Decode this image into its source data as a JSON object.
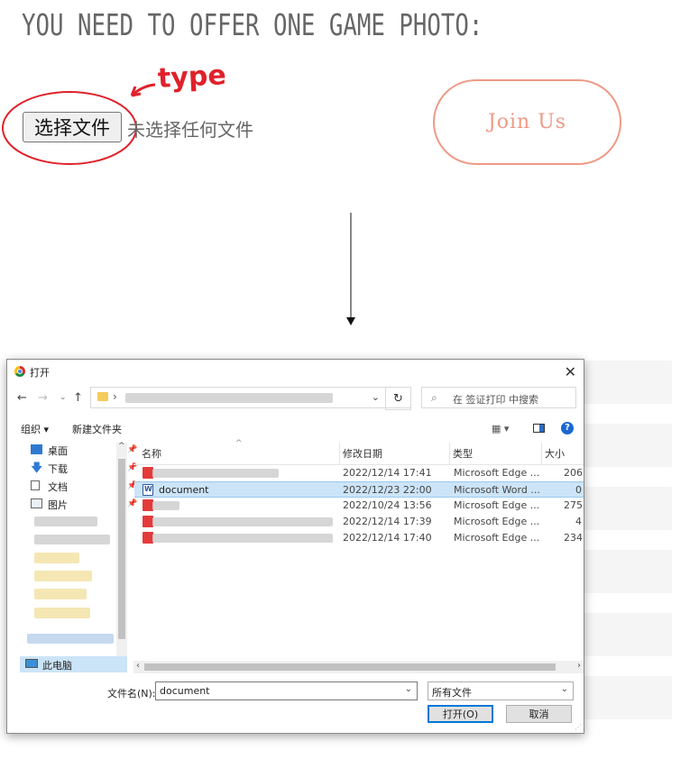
{
  "page": {
    "heading": "YOU NEED TO OFFER ONE GAME PHOTO:",
    "file_button_label": "选择文件",
    "file_status": "未选择任何文件",
    "join_button_label": "Join Us",
    "annotation_text": "type"
  },
  "dialog": {
    "title": "打开",
    "search_placeholder": "在 签证打印 中搜索",
    "toolbar": {
      "organize": "组织 ▾",
      "new_folder": "新建文件夹"
    },
    "nav_pane": {
      "desktop": "桌面",
      "downloads": "下载",
      "documents": "文档",
      "pictures": "图片",
      "this_pc": "此电脑"
    },
    "columns": {
      "name": "名称",
      "modified": "修改日期",
      "type": "类型",
      "size": "大小"
    },
    "files": [
      {
        "name": "",
        "modified": "2022/12/14 17:41",
        "type": "Microsoft Edge ...",
        "size": "206",
        "icon": "pdf-icon",
        "selected": false
      },
      {
        "name": "document",
        "modified": "2022/12/23 22:00",
        "type": "Microsoft Word ...",
        "size": "0",
        "icon": "word-icon",
        "selected": true
      },
      {
        "name": "",
        "modified": "2022/10/24 13:56",
        "type": "Microsoft Edge ...",
        "size": "275",
        "icon": "pdf-icon",
        "selected": false
      },
      {
        "name": "",
        "modified": "2022/12/14 17:39",
        "type": "Microsoft Edge ...",
        "size": "4",
        "icon": "pdf-icon",
        "selected": false
      },
      {
        "name": "",
        "modified": "2022/12/14 17:40",
        "type": "Microsoft Edge ...",
        "size": "234",
        "icon": "pdf-icon",
        "selected": false
      }
    ],
    "filename_label": "文件名(N):",
    "filename_value": "document",
    "filetype_value": "所有文件",
    "open_button": "打开(O)",
    "cancel_button": "取消"
  },
  "colors": {
    "annotation": "#e0212a",
    "join_button": "#ee9a86",
    "selection": "#cce4f7",
    "accent": "#0078d7"
  }
}
